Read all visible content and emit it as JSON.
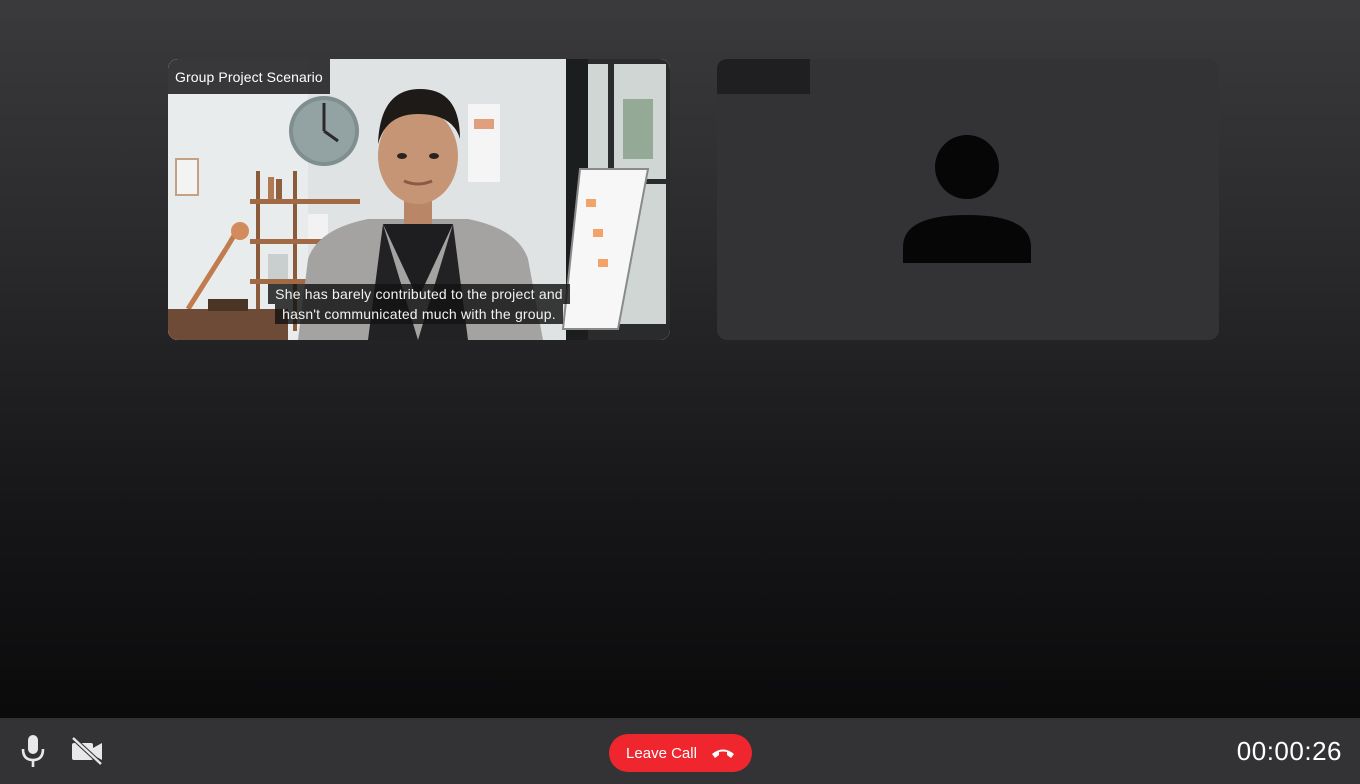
{
  "participants": [
    {
      "label": "Group Project Scenario",
      "caption_lines": [
        "She has barely contributed to the project and",
        "hasn't communicated much with the group."
      ],
      "video": "person-in-office"
    },
    {
      "label": "",
      "video": "avatar-placeholder"
    }
  ],
  "controls": {
    "mic_icon": "microphone-icon",
    "camera_icon": "camera-off-icon",
    "leave_label": "Leave Call",
    "leave_icon": "hang-up-icon",
    "leave_color": "#f0262f",
    "timer": "00:00:26"
  }
}
